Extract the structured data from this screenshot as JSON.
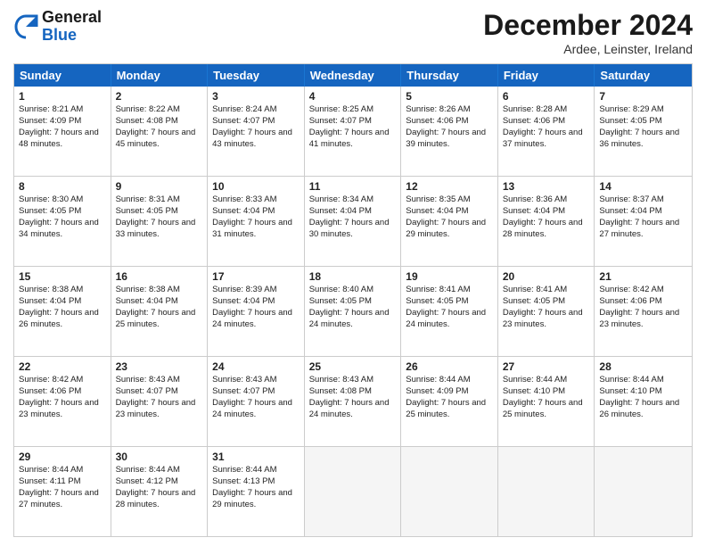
{
  "header": {
    "logo": {
      "line1": "General",
      "line2": "Blue"
    },
    "title": "December 2024",
    "location": "Ardee, Leinster, Ireland"
  },
  "days_of_week": [
    "Sunday",
    "Monday",
    "Tuesday",
    "Wednesday",
    "Thursday",
    "Friday",
    "Saturday"
  ],
  "weeks": [
    [
      {
        "day": "1",
        "sunrise": "Sunrise: 8:21 AM",
        "sunset": "Sunset: 4:09 PM",
        "daylight": "Daylight: 7 hours and 48 minutes."
      },
      {
        "day": "2",
        "sunrise": "Sunrise: 8:22 AM",
        "sunset": "Sunset: 4:08 PM",
        "daylight": "Daylight: 7 hours and 45 minutes."
      },
      {
        "day": "3",
        "sunrise": "Sunrise: 8:24 AM",
        "sunset": "Sunset: 4:07 PM",
        "daylight": "Daylight: 7 hours and 43 minutes."
      },
      {
        "day": "4",
        "sunrise": "Sunrise: 8:25 AM",
        "sunset": "Sunset: 4:07 PM",
        "daylight": "Daylight: 7 hours and 41 minutes."
      },
      {
        "day": "5",
        "sunrise": "Sunrise: 8:26 AM",
        "sunset": "Sunset: 4:06 PM",
        "daylight": "Daylight: 7 hours and 39 minutes."
      },
      {
        "day": "6",
        "sunrise": "Sunrise: 8:28 AM",
        "sunset": "Sunset: 4:06 PM",
        "daylight": "Daylight: 7 hours and 37 minutes."
      },
      {
        "day": "7",
        "sunrise": "Sunrise: 8:29 AM",
        "sunset": "Sunset: 4:05 PM",
        "daylight": "Daylight: 7 hours and 36 minutes."
      }
    ],
    [
      {
        "day": "8",
        "sunrise": "Sunrise: 8:30 AM",
        "sunset": "Sunset: 4:05 PM",
        "daylight": "Daylight: 7 hours and 34 minutes."
      },
      {
        "day": "9",
        "sunrise": "Sunrise: 8:31 AM",
        "sunset": "Sunset: 4:05 PM",
        "daylight": "Daylight: 7 hours and 33 minutes."
      },
      {
        "day": "10",
        "sunrise": "Sunrise: 8:33 AM",
        "sunset": "Sunset: 4:04 PM",
        "daylight": "Daylight: 7 hours and 31 minutes."
      },
      {
        "day": "11",
        "sunrise": "Sunrise: 8:34 AM",
        "sunset": "Sunset: 4:04 PM",
        "daylight": "Daylight: 7 hours and 30 minutes."
      },
      {
        "day": "12",
        "sunrise": "Sunrise: 8:35 AM",
        "sunset": "Sunset: 4:04 PM",
        "daylight": "Daylight: 7 hours and 29 minutes."
      },
      {
        "day": "13",
        "sunrise": "Sunrise: 8:36 AM",
        "sunset": "Sunset: 4:04 PM",
        "daylight": "Daylight: 7 hours and 28 minutes."
      },
      {
        "day": "14",
        "sunrise": "Sunrise: 8:37 AM",
        "sunset": "Sunset: 4:04 PM",
        "daylight": "Daylight: 7 hours and 27 minutes."
      }
    ],
    [
      {
        "day": "15",
        "sunrise": "Sunrise: 8:38 AM",
        "sunset": "Sunset: 4:04 PM",
        "daylight": "Daylight: 7 hours and 26 minutes."
      },
      {
        "day": "16",
        "sunrise": "Sunrise: 8:38 AM",
        "sunset": "Sunset: 4:04 PM",
        "daylight": "Daylight: 7 hours and 25 minutes."
      },
      {
        "day": "17",
        "sunrise": "Sunrise: 8:39 AM",
        "sunset": "Sunset: 4:04 PM",
        "daylight": "Daylight: 7 hours and 24 minutes."
      },
      {
        "day": "18",
        "sunrise": "Sunrise: 8:40 AM",
        "sunset": "Sunset: 4:05 PM",
        "daylight": "Daylight: 7 hours and 24 minutes."
      },
      {
        "day": "19",
        "sunrise": "Sunrise: 8:41 AM",
        "sunset": "Sunset: 4:05 PM",
        "daylight": "Daylight: 7 hours and 24 minutes."
      },
      {
        "day": "20",
        "sunrise": "Sunrise: 8:41 AM",
        "sunset": "Sunset: 4:05 PM",
        "daylight": "Daylight: 7 hours and 23 minutes."
      },
      {
        "day": "21",
        "sunrise": "Sunrise: 8:42 AM",
        "sunset": "Sunset: 4:06 PM",
        "daylight": "Daylight: 7 hours and 23 minutes."
      }
    ],
    [
      {
        "day": "22",
        "sunrise": "Sunrise: 8:42 AM",
        "sunset": "Sunset: 4:06 PM",
        "daylight": "Daylight: 7 hours and 23 minutes."
      },
      {
        "day": "23",
        "sunrise": "Sunrise: 8:43 AM",
        "sunset": "Sunset: 4:07 PM",
        "daylight": "Daylight: 7 hours and 23 minutes."
      },
      {
        "day": "24",
        "sunrise": "Sunrise: 8:43 AM",
        "sunset": "Sunset: 4:07 PM",
        "daylight": "Daylight: 7 hours and 24 minutes."
      },
      {
        "day": "25",
        "sunrise": "Sunrise: 8:43 AM",
        "sunset": "Sunset: 4:08 PM",
        "daylight": "Daylight: 7 hours and 24 minutes."
      },
      {
        "day": "26",
        "sunrise": "Sunrise: 8:44 AM",
        "sunset": "Sunset: 4:09 PM",
        "daylight": "Daylight: 7 hours and 25 minutes."
      },
      {
        "day": "27",
        "sunrise": "Sunrise: 8:44 AM",
        "sunset": "Sunset: 4:10 PM",
        "daylight": "Daylight: 7 hours and 25 minutes."
      },
      {
        "day": "28",
        "sunrise": "Sunrise: 8:44 AM",
        "sunset": "Sunset: 4:10 PM",
        "daylight": "Daylight: 7 hours and 26 minutes."
      }
    ],
    [
      {
        "day": "29",
        "sunrise": "Sunrise: 8:44 AM",
        "sunset": "Sunset: 4:11 PM",
        "daylight": "Daylight: 7 hours and 27 minutes."
      },
      {
        "day": "30",
        "sunrise": "Sunrise: 8:44 AM",
        "sunset": "Sunset: 4:12 PM",
        "daylight": "Daylight: 7 hours and 28 minutes."
      },
      {
        "day": "31",
        "sunrise": "Sunrise: 8:44 AM",
        "sunset": "Sunset: 4:13 PM",
        "daylight": "Daylight: 7 hours and 29 minutes."
      },
      null,
      null,
      null,
      null
    ]
  ]
}
